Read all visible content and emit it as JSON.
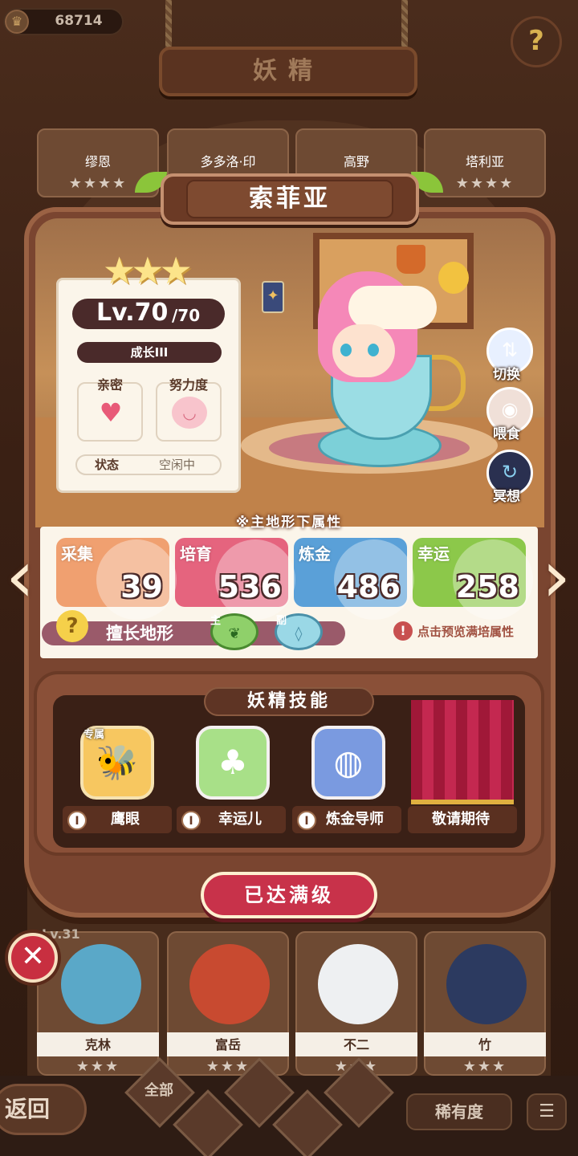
{
  "currency": {
    "icon": "crown-coin-icon",
    "value": "68714"
  },
  "header": {
    "title": "妖精"
  },
  "top_fairies": [
    {
      "name": "缪恩",
      "stars": "★★★★"
    },
    {
      "name": "多多洛·印",
      "stars": "★★★★"
    },
    {
      "name": "高野",
      "stars": "★★★★"
    },
    {
      "name": "塔利亚",
      "stars": "★★★★"
    }
  ],
  "fairy": {
    "name": "索菲亚",
    "stars": "★★★",
    "level": "Lv.70",
    "level_max": "/70",
    "growth": "成长III",
    "intimacy_label": "亲密",
    "effort_label": "努力度",
    "status_label": "状态",
    "status_value": "空闲中"
  },
  "actions": {
    "switch": "切换",
    "feed": "喂食",
    "meditate": "冥想"
  },
  "attributes": {
    "title": "※主地形下属性",
    "items": [
      {
        "name": "采集",
        "value": "39",
        "color": "#f0a070"
      },
      {
        "name": "培育",
        "value": "536",
        "color": "#e5647e"
      },
      {
        "name": "炼金",
        "value": "486",
        "color": "#5aa0d8"
      },
      {
        "name": "幸运",
        "value": "258",
        "color": "#8cc84a"
      }
    ],
    "terrain_label": "擅长地形",
    "terrain_main": "主",
    "terrain_sub": "副",
    "preview": "点击预览满培属性"
  },
  "skills": {
    "title": "妖精技能",
    "exclusive_tag": "专属",
    "items": [
      {
        "label": "鹰眼",
        "lv": "I",
        "icon": "bee-icon"
      },
      {
        "label": "幸运儿",
        "lv": "I",
        "icon": "clover-icon"
      },
      {
        "label": "炼金导师",
        "lv": "I",
        "icon": "cauldron-icon"
      },
      {
        "label": "敬请期待"
      }
    ]
  },
  "max_button": "已达满级",
  "bottom_fairies": [
    {
      "name": "克林",
      "stars": "★★★"
    },
    {
      "name": "富岳",
      "stars": "★★★"
    },
    {
      "name": "不二",
      "stars": "★★★"
    },
    {
      "name": "竹",
      "stars": "★★★"
    }
  ],
  "bottom_lv_tag": "Lv.31",
  "footer": {
    "back": "返回",
    "all": "全部",
    "rarity": "稀有度"
  }
}
